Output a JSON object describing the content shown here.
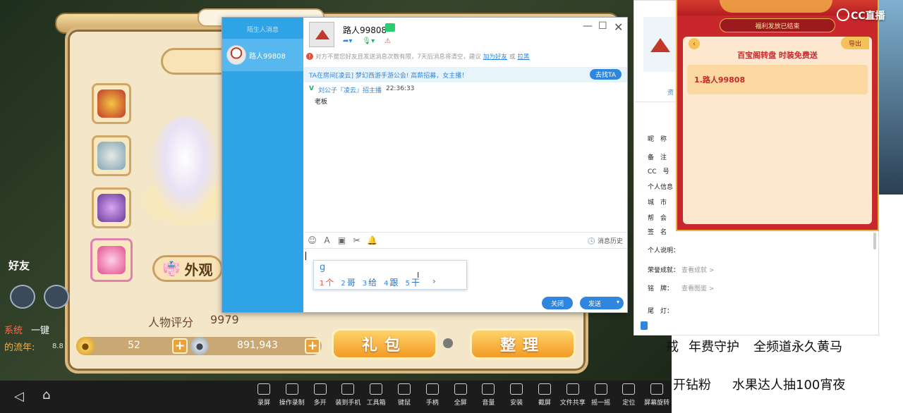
{
  "game": {
    "outfit_label": "外观",
    "rating_label": "人物评分",
    "rating_value": "9979",
    "gold_value": "52",
    "silver_value": "891,943",
    "plus_symbol": "+",
    "gift_label": "礼包",
    "sort_label": "整理",
    "friend_label": "好友",
    "chat_line_1_tag": "系统",
    "chat_line_1_text": "一键",
    "chat_line_2": "的流年:",
    "chat_line_2_small": "8.8"
  },
  "toolbar": {
    "back_icon": "◁",
    "home_icon": "⌂",
    "items": [
      {
        "label": "录屏"
      },
      {
        "label": "操作录制"
      },
      {
        "label": "多开"
      },
      {
        "label": "装到手机"
      },
      {
        "label": "工具箱"
      },
      {
        "label": "键鼠"
      },
      {
        "label": "手柄"
      },
      {
        "label": "全屏"
      },
      {
        "label": "音量"
      },
      {
        "label": "安装"
      },
      {
        "label": "截屏"
      },
      {
        "label": "文件共享"
      },
      {
        "label": "摇一摇"
      },
      {
        "label": "定位"
      },
      {
        "label": "屏幕旋转"
      }
    ]
  },
  "chat": {
    "sidebar_title": "陌生人消息",
    "contact_name": "路人99808",
    "name": "路人99808",
    "window_controls": {
      "minimize": "—",
      "maximize": "☐",
      "close": "✕"
    },
    "notice_text": "对方不是您好友且发送消息次数有限，7天后消息将清空，建议",
    "notice_link_add": "加为好友",
    "notice_or": "或",
    "notice_link_block": "拉黑",
    "ta_text": "TA在房间[凌云] 梦幻西游手游公会! 高薪招募，女主播！",
    "ta_button": "去找TA",
    "message": {
      "check": "V",
      "sender": "刘公子『凌云』招主播",
      "time": "22:36:33",
      "body": "老板"
    },
    "history_label": "消息历史",
    "ime": {
      "composition": "g",
      "candidates": [
        {
          "num": "1",
          "text": "个"
        },
        {
          "num": "2",
          "text": "哥"
        },
        {
          "num": "3",
          "text": "给"
        },
        {
          "num": "4",
          "text": "跟"
        },
        {
          "num": "5",
          "text": "干"
        }
      ],
      "next": "›"
    },
    "close_label": "关闭",
    "send_label": "发送",
    "send_dropdown": "▾"
  },
  "profile": {
    "tab": "资",
    "fields": [
      {
        "label": "昵　称",
        "value": ""
      },
      {
        "label": "备　注",
        "value": ""
      },
      {
        "label": "CC　号",
        "value": ""
      },
      {
        "label": "个人信息",
        "value": ""
      },
      {
        "label": "城　市",
        "value": ""
      },
      {
        "label": "帮　会",
        "value": ""
      },
      {
        "label": "签　名",
        "value": ""
      },
      {
        "label": "个人说明：",
        "value": ""
      },
      {
        "label": "荣誉成就：",
        "value": "查看成就 >"
      },
      {
        "label": "铭　牌：",
        "value": "查看图鉴 >"
      },
      {
        "label": "尾　灯：",
        "value": ""
      }
    ]
  },
  "event": {
    "status": "福利发放已结束",
    "back": "‹",
    "export": "导出",
    "title": "百宝阁转盘 时装免费送",
    "winner": "1.路人99808"
  },
  "brand": {
    "logo_text": "CC直播"
  },
  "promos": {
    "line1a": "戒",
    "line1b": "年费守护",
    "line1c": "全频道永久黄马",
    "line2a": "开钻粉",
    "line2b": "水果达人抽100宵夜"
  }
}
